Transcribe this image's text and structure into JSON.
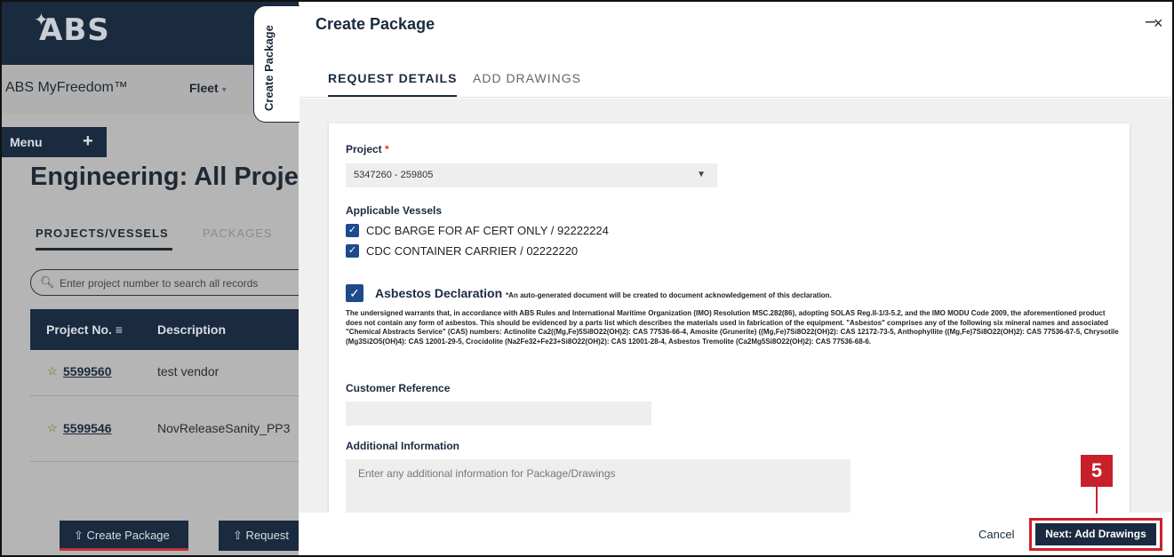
{
  "background": {
    "logo": "ABS",
    "brand": "ABS MyFreedom™",
    "fleet": "Fleet",
    "menu": "Menu",
    "page_title": "Engineering: All Proje",
    "tabs": {
      "projects": "PROJECTS/VESSELS",
      "packages": "PACKAGES"
    },
    "search_placeholder": "Enter project number to search all records",
    "table": {
      "col_project": "Project No.",
      "col_description": "Description",
      "rows": [
        {
          "project": "5599560",
          "description": "test vendor"
        },
        {
          "project": "5599546",
          "description": "NovReleaseSanity_PP3"
        }
      ]
    },
    "buttons": {
      "create_package": "Create Package",
      "request": "Request"
    }
  },
  "side_tab": "Create Package",
  "modal": {
    "title": "Create Package",
    "tabs": {
      "request_details": "REQUEST DETAILS",
      "add_drawings": "ADD DRAWINGS"
    },
    "project_label": "Project",
    "required_mark": "*",
    "project_value": "5347260 - 259805",
    "vessels_label": "Applicable Vessels",
    "vessels": [
      "CDC BARGE FOR AF CERT ONLY / 92222224",
      "CDC CONTAINER CARRIER / 02222220"
    ],
    "asbestos_title": "Asbestos Declaration",
    "asbestos_note": "*An auto-generated document will be created to document acknowledgement of this declaration.",
    "asbestos_body": "The undersigned warrants that, in accordance with ABS Rules and International Maritime Organization (IMO) Resolution MSC.282(86), adopting SOLAS Reg.II-1/3-5.2, and the IMO MODU Code 2009, the aforementioned product does not contain any form of asbestos. This should be evidenced by a parts list which describes the materials used in fabrication of the equipment. \"Asbestos\" comprises any of the following six mineral names and associated \"Chemical Abstracts Service\" (CAS) numbers: Actinolite Ca2((Mg,Fe)5Si8O22(OH)2): CAS 77536-66-4, Amosite (Grunerite) ((Mg,Fe)7Si8O22(OH)2): CAS 12172-73-5, Anthophyllite ((Mg,Fe)7Si8O22(OH)2): CAS 77536-67-5, Chrysotile (Mg3Si2O5(OH)4): CAS 12001-29-5, Crocidolite (Na2Fe32+Fe23+Si8O22(OH)2): CAS 12001-28-4, Asbestos Tremolite (Ca2Mg5Si8O22(OH)2): CAS 77536-68-6.",
    "customer_ref_label": "Customer Reference",
    "customer_ref_value": "",
    "additional_label": "Additional Information",
    "additional_placeholder": "Enter any additional information for Package/Drawings",
    "cancel": "Cancel",
    "next": "Next: Add Drawings"
  },
  "annotation_step": "5",
  "colors": {
    "navy": "#1a2a3f",
    "accent_red": "#c8202a",
    "checkbox_blue": "#1e4a8d"
  }
}
